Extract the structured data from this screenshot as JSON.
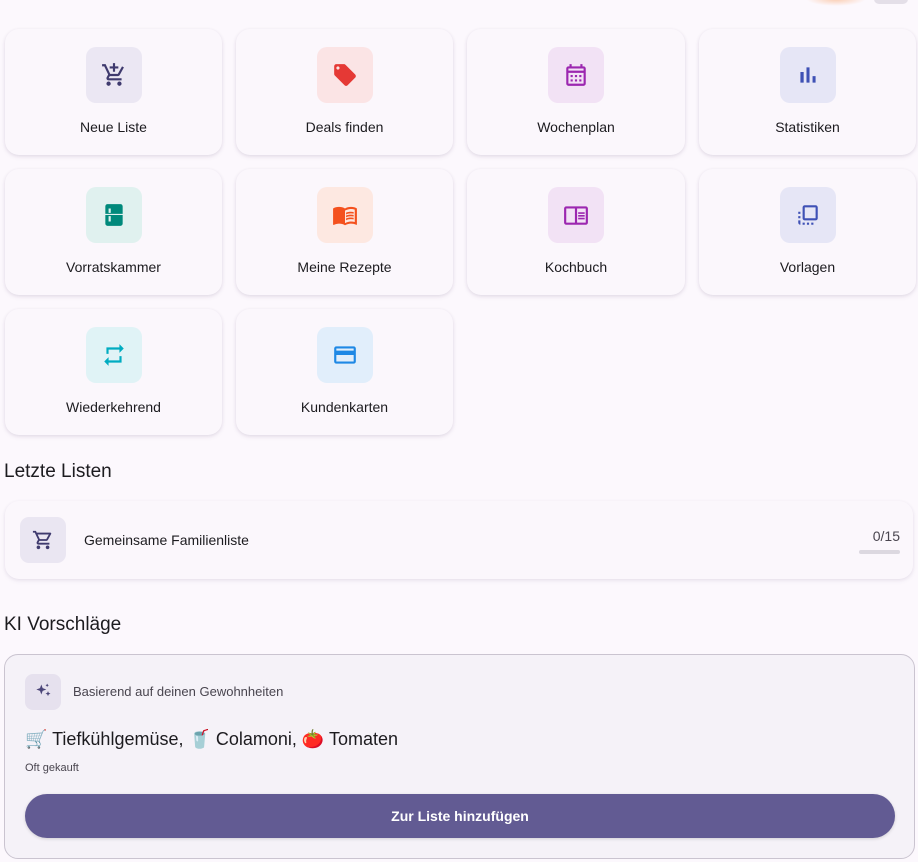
{
  "actions": [
    {
      "label": "Neue Liste",
      "icon": "add-cart-icon",
      "color": "#3f3a6e",
      "bg": "#ebe7f3"
    },
    {
      "label": "Deals finden",
      "icon": "tag-icon",
      "color": "#e53935",
      "bg": "#fbe4e5"
    },
    {
      "label": "Wochenplan",
      "icon": "calendar-icon",
      "color": "#9c27b0",
      "bg": "#f2e2f5"
    },
    {
      "label": "Statistiken",
      "icon": "bar-chart-icon",
      "color": "#3f51b5",
      "bg": "#e6e6f6"
    },
    {
      "label": "Vorratskammer",
      "icon": "fridge-icon",
      "color": "#00897b",
      "bg": "#e0f1ef"
    },
    {
      "label": "Meine Rezepte",
      "icon": "book-icon",
      "color": "#f4511e",
      "bg": "#fde8e1"
    },
    {
      "label": "Kochbuch",
      "icon": "open-book-icon",
      "color": "#9c27b0",
      "bg": "#f2e2f5"
    },
    {
      "label": "Vorlagen",
      "icon": "template-icon",
      "color": "#3f51b5",
      "bg": "#e6e6f6"
    },
    {
      "label": "Wiederkehrend",
      "icon": "repeat-icon",
      "color": "#00acc1",
      "bg": "#e0f3f6"
    },
    {
      "label": "Kundenkarten",
      "icon": "card-icon",
      "color": "#1e88e5",
      "bg": "#e1eefb"
    }
  ],
  "recent": {
    "title": "Letzte Listen",
    "items": [
      {
        "name": "Gemeinsame Familienliste",
        "count": "0/15",
        "progress": 0
      }
    ]
  },
  "ai": {
    "title": "KI Vorschläge",
    "caption": "Basierend auf deinen Gewohnheiten",
    "items_text": "🛒 Tiefkühlgemüse, 🥤 Colamoni, 🍅 Tomaten",
    "subtext": "Oft gekauft",
    "button_label": "Zur Liste hinzufügen"
  },
  "colors": {
    "accent": "#625b93",
    "background": "#fcf8fd"
  }
}
